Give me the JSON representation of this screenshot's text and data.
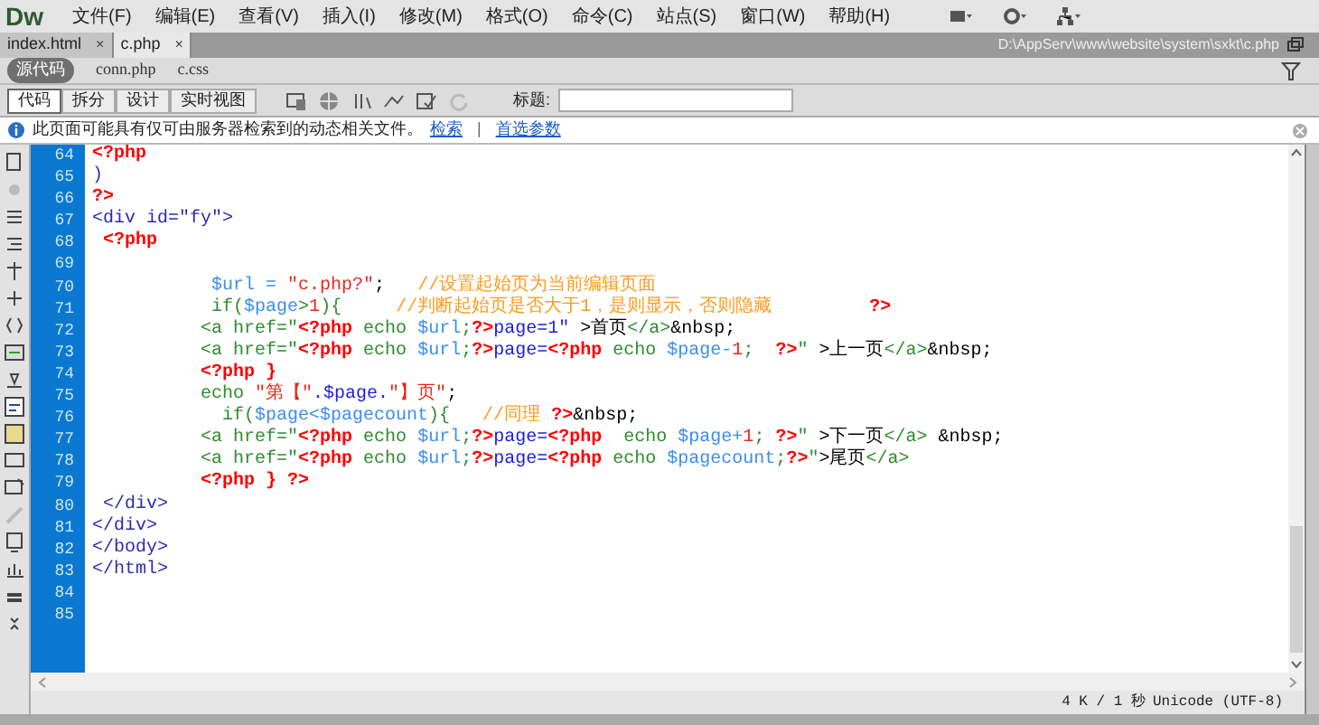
{
  "app": {
    "logo": "Dw",
    "menu": [
      "文件(F)",
      "编辑(E)",
      "查看(V)",
      "插入(I)",
      "修改(M)",
      "格式(O)",
      "命令(C)",
      "站点(S)",
      "窗口(W)",
      "帮助(H)"
    ]
  },
  "tabs": [
    {
      "label": "index.html",
      "selected": false,
      "close": "×"
    },
    {
      "label": "c.php",
      "selected": true,
      "close": "×"
    }
  ],
  "file_path": "D:\\AppServ\\www\\website\\system\\sxkt\\c.php",
  "related_files": [
    {
      "label": "源代码",
      "selected": true
    },
    {
      "label": "conn.php",
      "selected": false
    },
    {
      "label": "c.css",
      "selected": false
    }
  ],
  "view_buttons": [
    {
      "label": "代码",
      "selected": true
    },
    {
      "label": "拆分",
      "selected": false
    },
    {
      "label": "设计",
      "selected": false
    },
    {
      "label": "实时视图",
      "selected": false
    }
  ],
  "title_field": {
    "label": "标题:"
  },
  "info_bar": {
    "message": "此页面可能具有仅可由服务器检索到的动态相关文件。",
    "links": [
      "检索",
      "首选参数"
    ],
    "separator": "|"
  },
  "code_lines": [
    {
      "number": "64",
      "tokens": [
        {
          "kind": "php",
          "text": "<?php"
        }
      ]
    },
    {
      "number": "65",
      "tokens": [
        {
          "kind": "tag",
          "text": ")"
        }
      ]
    },
    {
      "number": "66",
      "tokens": [
        {
          "kind": "php",
          "text": "?>"
        }
      ]
    },
    {
      "number": "67",
      "tokens": [
        {
          "kind": "tag",
          "text": "<div id=\"fy\">"
        }
      ]
    },
    {
      "number": "68",
      "tokens": [
        {
          "kind": "php",
          "text": " <?php"
        }
      ]
    },
    {
      "number": "69"
    },
    {
      "number": "70",
      "tokens": [
        {
          "kind": "var",
          "text": "           $url = "
        },
        {
          "kind": "red",
          "text": "\"c.php?\""
        },
        {
          "kind": "plain",
          "text": ";   "
        },
        {
          "kind": "cmt",
          "text": "//设置起始页为当前编辑页面"
        }
      ]
    },
    {
      "number": "71",
      "tokens": [
        {
          "kind": "green",
          "text": "           if("
        },
        {
          "kind": "var",
          "text": "$page"
        },
        {
          "kind": "green",
          "text": ">"
        },
        {
          "kind": "red",
          "text": "1"
        },
        {
          "kind": "green",
          "text": "){     "
        },
        {
          "kind": "cmt",
          "text": "//判断起始页是否大于1，是则显示，否则隐藏"
        },
        {
          "kind": "php",
          "text": "         ?>"
        }
      ]
    },
    {
      "number": "72",
      "tokens": [
        {
          "kind": "green",
          "text": "          <a href=\""
        },
        {
          "kind": "php",
          "text": "<?php"
        },
        {
          "kind": "green",
          "text": " echo "
        },
        {
          "kind": "var",
          "text": "$url"
        },
        {
          "kind": "green",
          "text": ";"
        },
        {
          "kind": "php",
          "text": "?>"
        },
        {
          "kind": "blue",
          "text": "page=1\""
        },
        {
          "kind": "plain",
          "text": " >首页"
        },
        {
          "kind": "green",
          "text": "</a>"
        },
        {
          "kind": "plain",
          "text": "&nbsp;"
        }
      ]
    },
    {
      "number": "73",
      "tokens": [
        {
          "kind": "green",
          "text": "          <a href=\""
        },
        {
          "kind": "php",
          "text": "<?php"
        },
        {
          "kind": "green",
          "text": " echo "
        },
        {
          "kind": "var",
          "text": "$url"
        },
        {
          "kind": "green",
          "text": ";"
        },
        {
          "kind": "php",
          "text": "?>"
        },
        {
          "kind": "blue",
          "text": "page="
        },
        {
          "kind": "php",
          "text": "<?php"
        },
        {
          "kind": "green",
          "text": " echo "
        },
        {
          "kind": "var",
          "text": "$page-"
        },
        {
          "kind": "red",
          "text": "1"
        },
        {
          "kind": "green",
          "text": ";  "
        },
        {
          "kind": "php",
          "text": "?>"
        },
        {
          "kind": "green",
          "text": "\""
        },
        {
          "kind": "plain",
          "text": " >上一页"
        },
        {
          "kind": "green",
          "text": "</a>"
        },
        {
          "kind": "plain",
          "text": "&nbsp;"
        }
      ]
    },
    {
      "number": "74",
      "tokens": [
        {
          "kind": "php",
          "text": "          <?php }"
        }
      ]
    },
    {
      "number": "75",
      "tokens": [
        {
          "kind": "green",
          "text": "          echo "
        },
        {
          "kind": "red",
          "text": "\"第【\""
        },
        {
          "kind": "blue",
          "text": ".$page."
        },
        {
          "kind": "red",
          "text": "\"】页\""
        },
        {
          "kind": "plain",
          "text": ";"
        }
      ]
    },
    {
      "number": "76",
      "tokens": [
        {
          "kind": "green",
          "text": "            if("
        },
        {
          "kind": "var",
          "text": "$page<$pagecount"
        },
        {
          "kind": "green",
          "text": "){   "
        },
        {
          "kind": "cmt",
          "text": "//同理 "
        },
        {
          "kind": "php",
          "text": "?>"
        },
        {
          "kind": "plain",
          "text": "&nbsp;"
        }
      ]
    },
    {
      "number": "77",
      "tokens": [
        {
          "kind": "green",
          "text": "          <a href=\""
        },
        {
          "kind": "php",
          "text": "<?php"
        },
        {
          "kind": "green",
          "text": " echo "
        },
        {
          "kind": "var",
          "text": "$url"
        },
        {
          "kind": "green",
          "text": ";"
        },
        {
          "kind": "php",
          "text": "?>"
        },
        {
          "kind": "blue",
          "text": "page="
        },
        {
          "kind": "php",
          "text": "<?php"
        },
        {
          "kind": "green",
          "text": "  echo "
        },
        {
          "kind": "var",
          "text": "$page+"
        },
        {
          "kind": "red",
          "text": "1"
        },
        {
          "kind": "green",
          "text": "; "
        },
        {
          "kind": "php",
          "text": "?>"
        },
        {
          "kind": "green",
          "text": "\""
        },
        {
          "kind": "plain",
          "text": " >下一页"
        },
        {
          "kind": "green",
          "text": "</a>"
        },
        {
          "kind": "plain",
          "text": " &nbsp;"
        }
      ]
    },
    {
      "number": "78",
      "tokens": [
        {
          "kind": "green",
          "text": "          <a href=\""
        },
        {
          "kind": "php",
          "text": "<?php"
        },
        {
          "kind": "green",
          "text": " echo "
        },
        {
          "kind": "var",
          "text": "$url"
        },
        {
          "kind": "green",
          "text": ";"
        },
        {
          "kind": "php",
          "text": "?>"
        },
        {
          "kind": "blue",
          "text": "page="
        },
        {
          "kind": "php",
          "text": "<?php"
        },
        {
          "kind": "green",
          "text": " echo "
        },
        {
          "kind": "var",
          "text": "$pagecount"
        },
        {
          "kind": "green",
          "text": ";"
        },
        {
          "kind": "php",
          "text": "?>"
        },
        {
          "kind": "green",
          "text": "\""
        },
        {
          "kind": "plain",
          "text": ">尾页"
        },
        {
          "kind": "green",
          "text": "</a>"
        }
      ]
    },
    {
      "number": "79",
      "tokens": [
        {
          "kind": "php",
          "text": "          <?php } ?>"
        }
      ]
    },
    {
      "number": "80",
      "tokens": [
        {
          "kind": "tag",
          "text": " </div>"
        }
      ]
    },
    {
      "number": "81",
      "tokens": [
        {
          "kind": "tag",
          "text": "</div>"
        }
      ]
    },
    {
      "number": "82",
      "tokens": [
        {
          "kind": "tag",
          "text": "</body>"
        }
      ]
    },
    {
      "number": "83",
      "tokens": [
        {
          "kind": "tag",
          "text": "</html>"
        }
      ]
    },
    {
      "number": "84"
    },
    {
      "number": "85"
    }
  ],
  "status_bar": {
    "size": "4 K / 1 秒",
    "encoding": "Unicode (UTF-8)"
  }
}
